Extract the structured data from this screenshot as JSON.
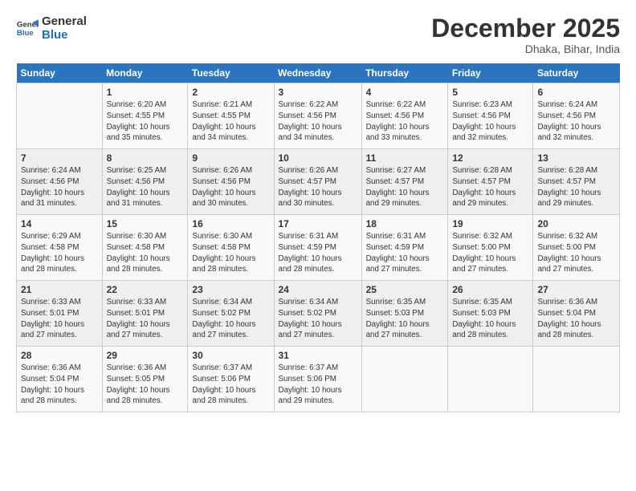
{
  "logo": {
    "line1": "General",
    "line2": "Blue"
  },
  "title": "December 2025",
  "subtitle": "Dhaka, Bihar, India",
  "header_days": [
    "Sunday",
    "Monday",
    "Tuesday",
    "Wednesday",
    "Thursday",
    "Friday",
    "Saturday"
  ],
  "weeks": [
    [
      {
        "day": "",
        "info": ""
      },
      {
        "day": "1",
        "info": "Sunrise: 6:20 AM\nSunset: 4:55 PM\nDaylight: 10 hours\nand 35 minutes."
      },
      {
        "day": "2",
        "info": "Sunrise: 6:21 AM\nSunset: 4:55 PM\nDaylight: 10 hours\nand 34 minutes."
      },
      {
        "day": "3",
        "info": "Sunrise: 6:22 AM\nSunset: 4:56 PM\nDaylight: 10 hours\nand 34 minutes."
      },
      {
        "day": "4",
        "info": "Sunrise: 6:22 AM\nSunset: 4:56 PM\nDaylight: 10 hours\nand 33 minutes."
      },
      {
        "day": "5",
        "info": "Sunrise: 6:23 AM\nSunset: 4:56 PM\nDaylight: 10 hours\nand 32 minutes."
      },
      {
        "day": "6",
        "info": "Sunrise: 6:24 AM\nSunset: 4:56 PM\nDaylight: 10 hours\nand 32 minutes."
      }
    ],
    [
      {
        "day": "7",
        "info": "Sunrise: 6:24 AM\nSunset: 4:56 PM\nDaylight: 10 hours\nand 31 minutes."
      },
      {
        "day": "8",
        "info": "Sunrise: 6:25 AM\nSunset: 4:56 PM\nDaylight: 10 hours\nand 31 minutes."
      },
      {
        "day": "9",
        "info": "Sunrise: 6:26 AM\nSunset: 4:56 PM\nDaylight: 10 hours\nand 30 minutes."
      },
      {
        "day": "10",
        "info": "Sunrise: 6:26 AM\nSunset: 4:57 PM\nDaylight: 10 hours\nand 30 minutes."
      },
      {
        "day": "11",
        "info": "Sunrise: 6:27 AM\nSunset: 4:57 PM\nDaylight: 10 hours\nand 29 minutes."
      },
      {
        "day": "12",
        "info": "Sunrise: 6:28 AM\nSunset: 4:57 PM\nDaylight: 10 hours\nand 29 minutes."
      },
      {
        "day": "13",
        "info": "Sunrise: 6:28 AM\nSunset: 4:57 PM\nDaylight: 10 hours\nand 29 minutes."
      }
    ],
    [
      {
        "day": "14",
        "info": "Sunrise: 6:29 AM\nSunset: 4:58 PM\nDaylight: 10 hours\nand 28 minutes."
      },
      {
        "day": "15",
        "info": "Sunrise: 6:30 AM\nSunset: 4:58 PM\nDaylight: 10 hours\nand 28 minutes."
      },
      {
        "day": "16",
        "info": "Sunrise: 6:30 AM\nSunset: 4:58 PM\nDaylight: 10 hours\nand 28 minutes."
      },
      {
        "day": "17",
        "info": "Sunrise: 6:31 AM\nSunset: 4:59 PM\nDaylight: 10 hours\nand 28 minutes."
      },
      {
        "day": "18",
        "info": "Sunrise: 6:31 AM\nSunset: 4:59 PM\nDaylight: 10 hours\nand 27 minutes."
      },
      {
        "day": "19",
        "info": "Sunrise: 6:32 AM\nSunset: 5:00 PM\nDaylight: 10 hours\nand 27 minutes."
      },
      {
        "day": "20",
        "info": "Sunrise: 6:32 AM\nSunset: 5:00 PM\nDaylight: 10 hours\nand 27 minutes."
      }
    ],
    [
      {
        "day": "21",
        "info": "Sunrise: 6:33 AM\nSunset: 5:01 PM\nDaylight: 10 hours\nand 27 minutes."
      },
      {
        "day": "22",
        "info": "Sunrise: 6:33 AM\nSunset: 5:01 PM\nDaylight: 10 hours\nand 27 minutes."
      },
      {
        "day": "23",
        "info": "Sunrise: 6:34 AM\nSunset: 5:02 PM\nDaylight: 10 hours\nand 27 minutes."
      },
      {
        "day": "24",
        "info": "Sunrise: 6:34 AM\nSunset: 5:02 PM\nDaylight: 10 hours\nand 27 minutes."
      },
      {
        "day": "25",
        "info": "Sunrise: 6:35 AM\nSunset: 5:03 PM\nDaylight: 10 hours\nand 27 minutes."
      },
      {
        "day": "26",
        "info": "Sunrise: 6:35 AM\nSunset: 5:03 PM\nDaylight: 10 hours\nand 28 minutes."
      },
      {
        "day": "27",
        "info": "Sunrise: 6:36 AM\nSunset: 5:04 PM\nDaylight: 10 hours\nand 28 minutes."
      }
    ],
    [
      {
        "day": "28",
        "info": "Sunrise: 6:36 AM\nSunset: 5:04 PM\nDaylight: 10 hours\nand 28 minutes."
      },
      {
        "day": "29",
        "info": "Sunrise: 6:36 AM\nSunset: 5:05 PM\nDaylight: 10 hours\nand 28 minutes."
      },
      {
        "day": "30",
        "info": "Sunrise: 6:37 AM\nSunset: 5:06 PM\nDaylight: 10 hours\nand 28 minutes."
      },
      {
        "day": "31",
        "info": "Sunrise: 6:37 AM\nSunset: 5:06 PM\nDaylight: 10 hours\nand 29 minutes."
      },
      {
        "day": "",
        "info": ""
      },
      {
        "day": "",
        "info": ""
      },
      {
        "day": "",
        "info": ""
      }
    ]
  ]
}
